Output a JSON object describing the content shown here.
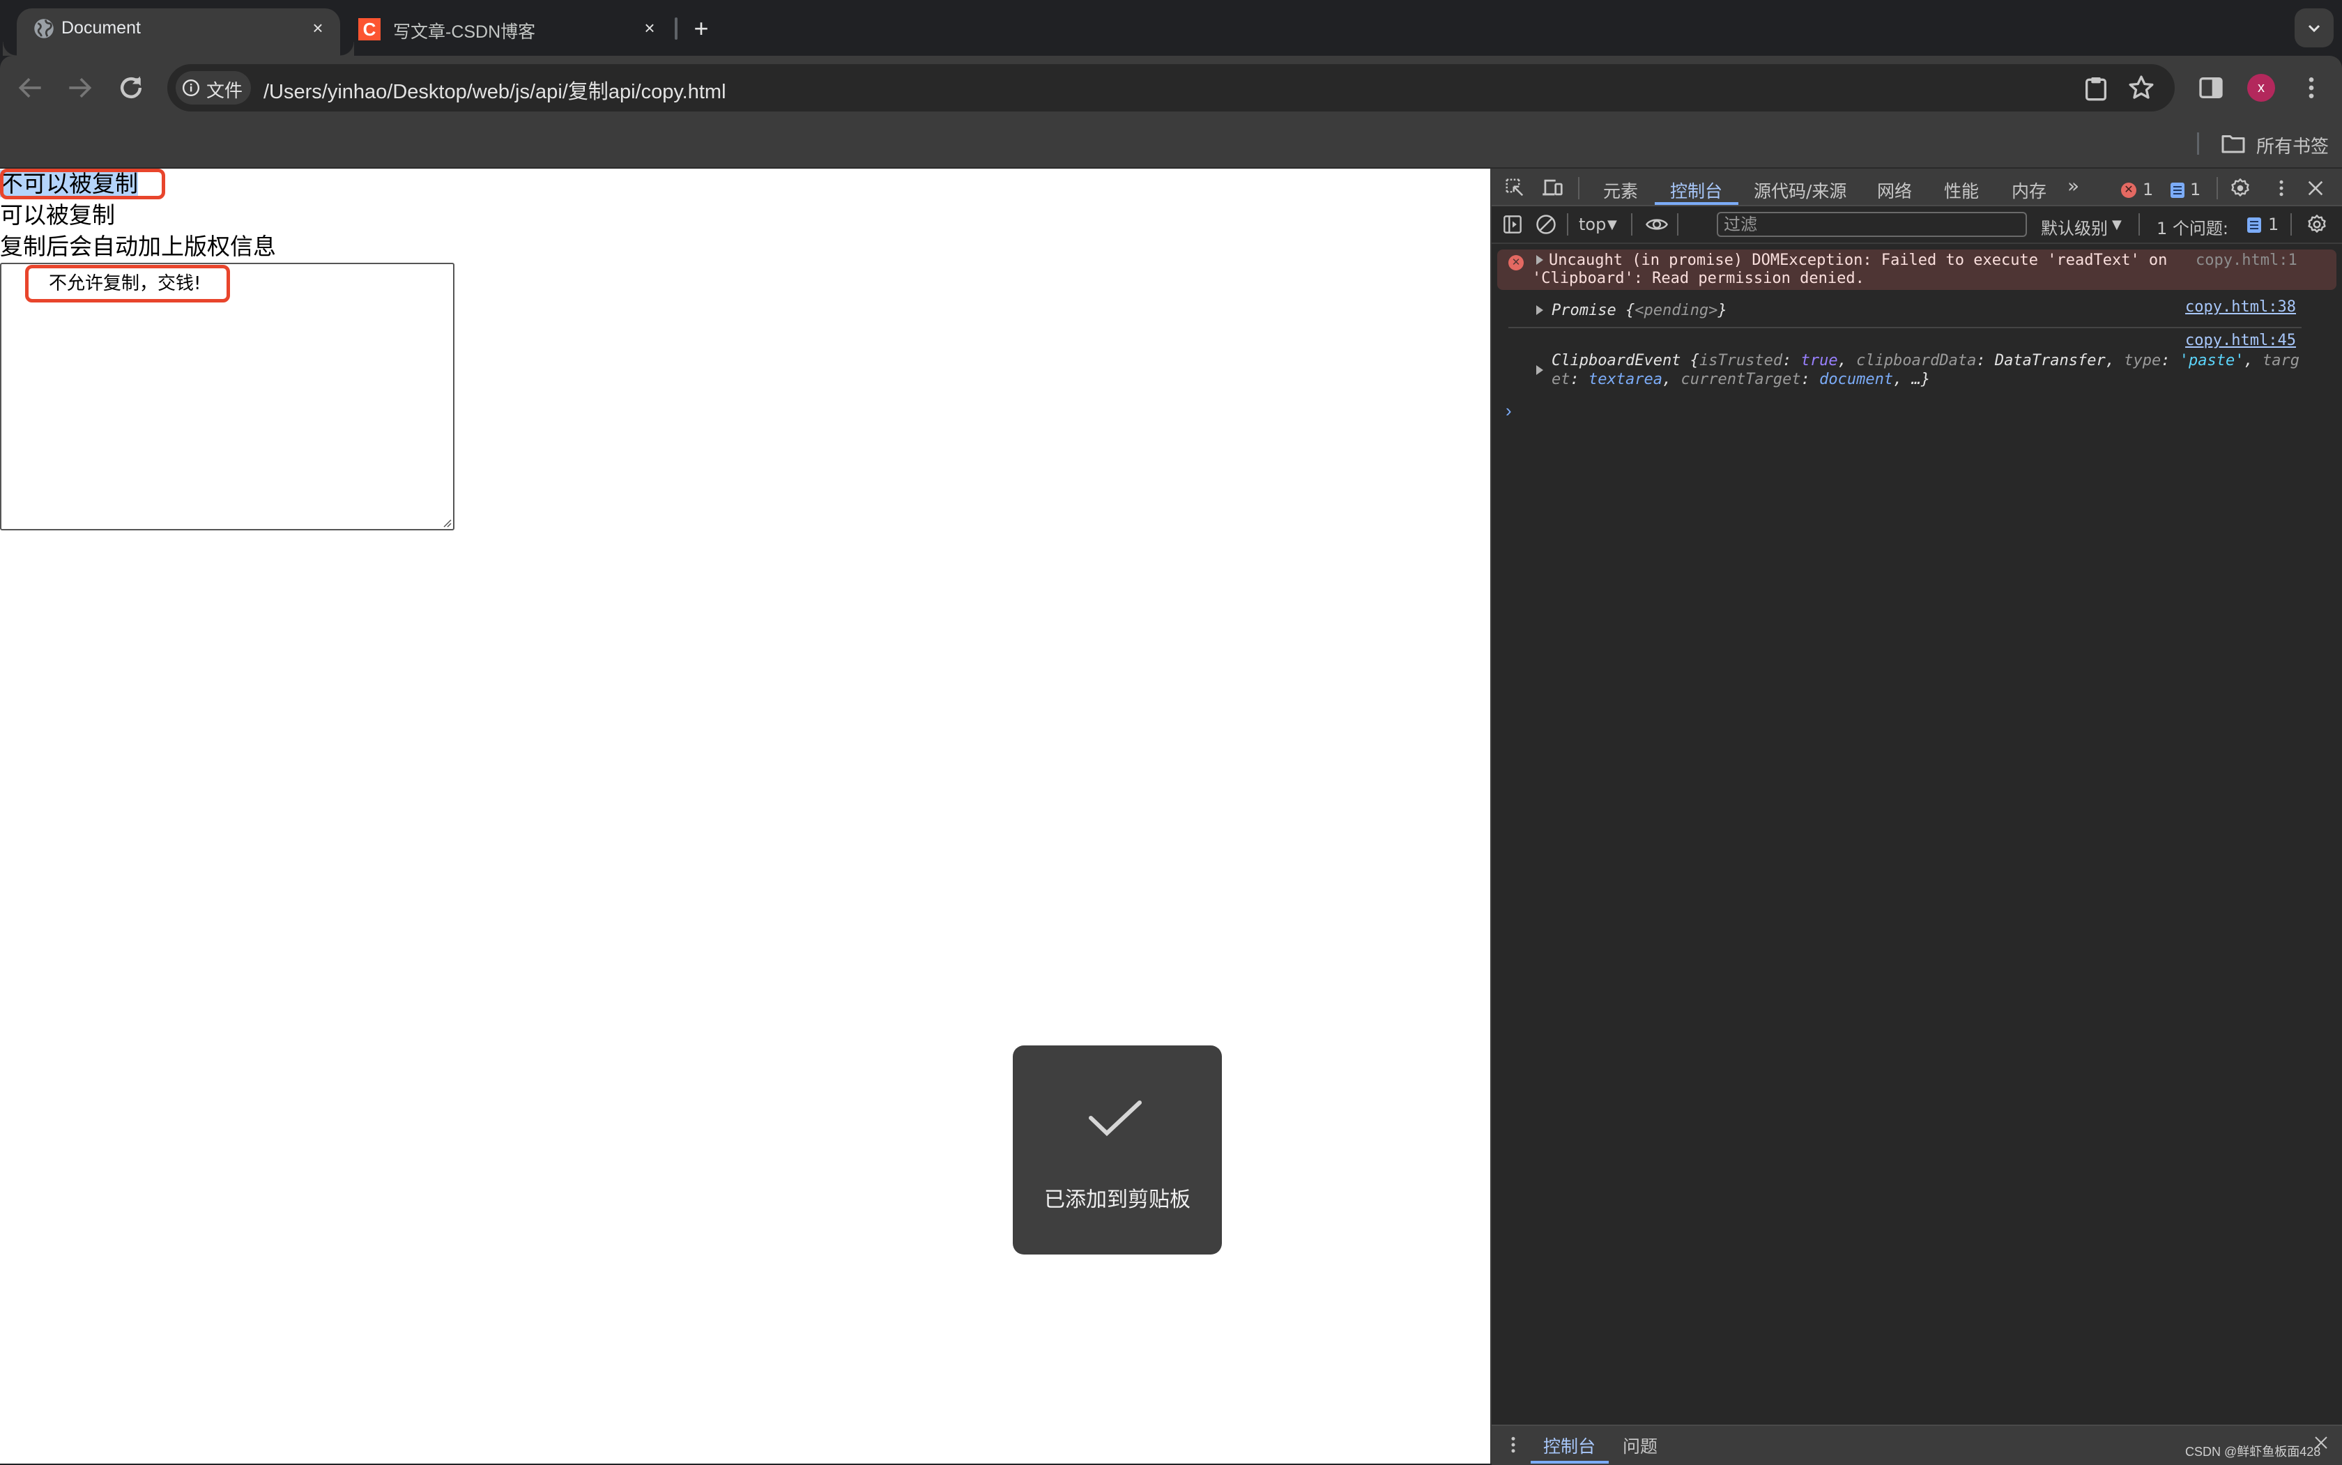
{
  "browser": {
    "tabs": [
      {
        "title": "Document",
        "favicon": "globe-icon",
        "active": true
      },
      {
        "title": "写文章-CSDN博客",
        "favicon": "csdn-icon",
        "favicon_letter": "C",
        "active": false
      }
    ],
    "new_tab_label": "+",
    "close_glyph": "×",
    "address_bar": {
      "chip_label": "文件",
      "url": "/Users/yinhao/Desktop/web/js/api/复制api/copy.html"
    },
    "profile_initial": "x",
    "bookmarks_label": "所有书签",
    "accent_colors": {
      "avatar": "#b3285c",
      "csdn": "#fc5531"
    }
  },
  "page": {
    "lines": [
      {
        "text": "不可以被复制",
        "selected": true
      },
      {
        "text": "可以被复制"
      },
      {
        "text": "复制后会自动加上版权信息"
      }
    ],
    "textarea_value": "不允许复制，交钱!",
    "annotation_color": "#e8452c"
  },
  "toast": {
    "icon": "checkmark-icon",
    "message": "已添加到剪贴板"
  },
  "devtools": {
    "tabs": [
      "元素",
      "控制台",
      "源代码/来源",
      "网络",
      "性能",
      "内存"
    ],
    "active_tab": "控制台",
    "more_tabs_glyph": "»",
    "error_count": "1",
    "message_count": "1",
    "console_toolbar": {
      "context": "top",
      "filter_placeholder": "过滤",
      "level": "默认级别",
      "issues_label": "1 个问题:",
      "issues_count": "1"
    },
    "console": {
      "error": {
        "line1": "Uncaught (in promise) DOMException: Failed to execute 'readText' on",
        "line2": "'Clipboard': Read permission denied.",
        "source": "copy.html:1"
      },
      "promise": {
        "name": "Promise",
        "open": " {",
        "state": "<pending>",
        "close": "}",
        "source": "copy.html:38"
      },
      "event": {
        "source": "copy.html:45",
        "name": "ClipboardEvent",
        "k_isTrusted": "isTrusted",
        "v_isTrusted": "true",
        "k_clipboardData": "clipboardData",
        "v_clipboardData": "DataTransfer",
        "k_type": "type",
        "v_type": "'paste'",
        "k_target_a": "targ",
        "k_target_b": "et",
        "v_target": "textarea",
        "k_currentTarget": "currentTarget",
        "v_currentTarget": "document",
        "ellipsis": "…}"
      },
      "prompt": "›"
    },
    "drawer_tabs": [
      "控制台",
      "问题"
    ],
    "drawer_active": "控制台"
  },
  "watermark": "CSDN @鲜虾鱼板面428"
}
